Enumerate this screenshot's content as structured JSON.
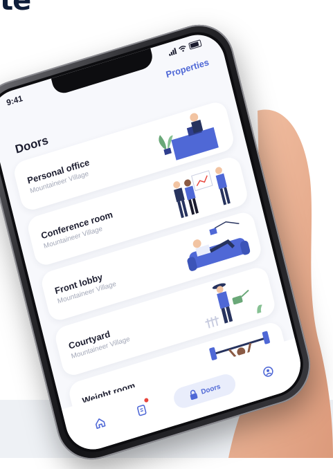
{
  "headline": {
    "fragment": "te"
  },
  "status_bar": {
    "time": "9:41"
  },
  "header": {
    "title": "Doors",
    "properties_link": "Properties"
  },
  "doors": [
    {
      "title": "Personal office",
      "subtitle": "Mountaineer Village",
      "illustration": "office-desk-illustration"
    },
    {
      "title": "Conference room",
      "subtitle": "Mountaineer Village",
      "illustration": "meeting-people-illustration"
    },
    {
      "title": "Front lobby",
      "subtitle": "Mountaineer Village",
      "illustration": "sofa-lounge-illustration"
    },
    {
      "title": "Courtyard",
      "subtitle": "Mountaineer Village",
      "illustration": "gardener-illustration"
    },
    {
      "title": "Weight room",
      "subtitle": "Mountaineer Village",
      "illustration": "weightlifter-illustration"
    }
  ],
  "tab_bar": {
    "tabs": [
      {
        "icon": "home-icon"
      },
      {
        "icon": "document-icon",
        "has_notification": true
      },
      {
        "icon": "lock-icon",
        "label": "Doors",
        "active": true
      },
      {
        "icon": "user-circle-icon"
      }
    ]
  },
  "colors": {
    "accent": "#4f68d6",
    "accent_soft": "#e9edfb",
    "text_dark": "#1b1c2e",
    "text_muted": "#a3a8b8",
    "notification": "#e8453c",
    "headline": "#0f1e3a"
  }
}
